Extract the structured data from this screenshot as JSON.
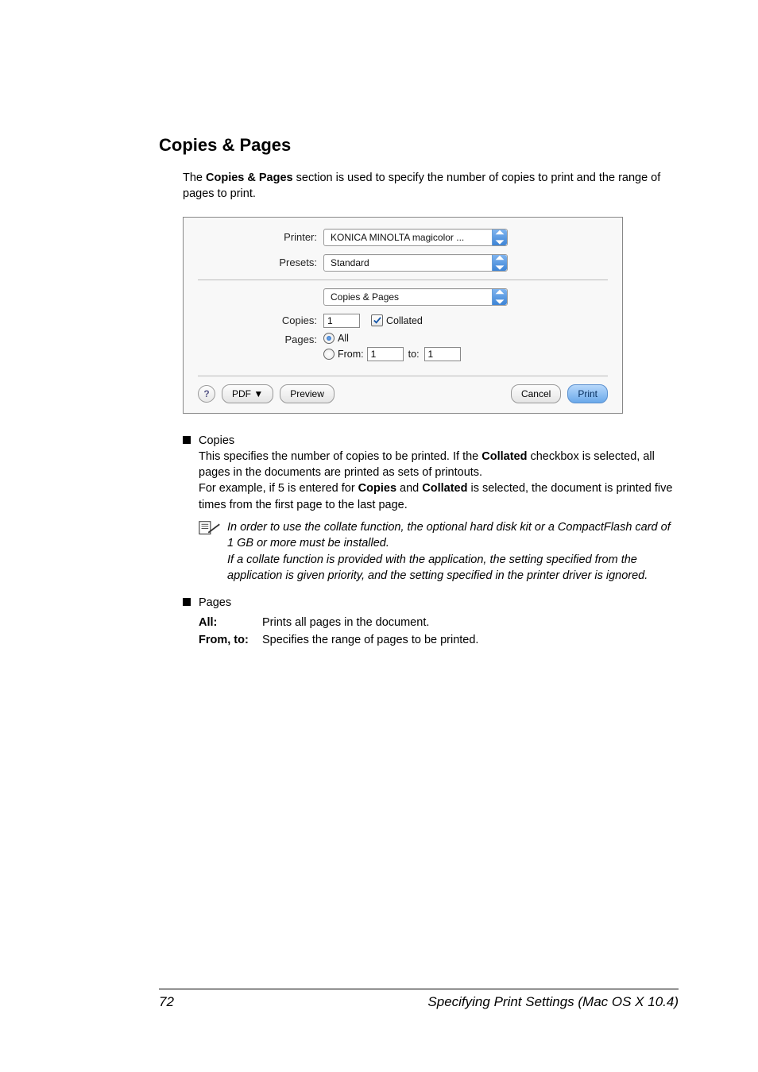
{
  "heading": "Copies & Pages",
  "intro_parts": {
    "p1": "The ",
    "bold": "Copies & Pages",
    "p2": " section is used to specify the number of copies to print and the range of pages to print."
  },
  "dialog": {
    "printer_label": "Printer:",
    "printer_value": "KONICA MINOLTA magicolor ...",
    "presets_label": "Presets:",
    "presets_value": "Standard",
    "section_value": "Copies & Pages",
    "copies_label": "Copies:",
    "copies_value": "1",
    "collated_label": "Collated",
    "pages_label": "Pages:",
    "all_label": "All",
    "from_label": "From:",
    "from_value": "1",
    "to_label": "to:",
    "to_value": "1",
    "help_label": "?",
    "pdf_label": "PDF ▼",
    "preview_label": "Preview",
    "cancel_label": "Cancel",
    "print_label": "Print"
  },
  "copies_bullet": {
    "title": "Copies",
    "body_p1": "This specifies the number of copies to be printed. If the ",
    "body_b1": "Collated",
    "body_p2": " checkbox is selected, all pages in the documents are printed as sets of printouts.",
    "body_p3": "For example, if 5 is entered for ",
    "body_b2": "Copies",
    "body_p4": " and ",
    "body_b3": "Collated",
    "body_p5": " is selected, the document is printed five times from the first page to the last page.",
    "note": "In order to use the collate function, the optional hard disk kit or a CompactFlash card of 1 GB or more must be installed.\nIf a collate function is provided with the application, the setting specified from the application is given priority, and the setting specified in the printer driver is ignored."
  },
  "pages_bullet": {
    "title": "Pages",
    "all_key": "All",
    "all_desc": "Prints all pages in the document.",
    "fromto_key": "From, to",
    "fromto_desc": "Specifies the range of pages to be printed."
  },
  "footer": {
    "page": "72",
    "title": "Specifying Print Settings (Mac OS X 10.4)"
  }
}
